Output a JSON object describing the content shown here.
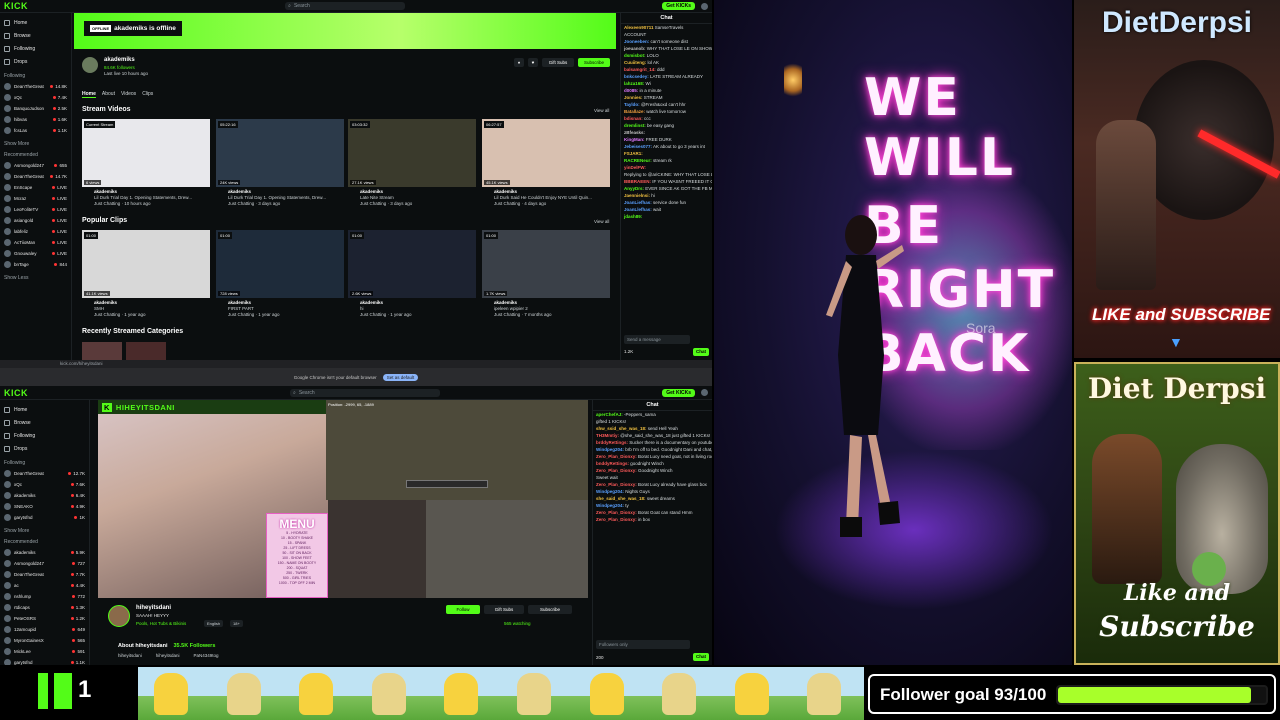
{
  "top_pane": {
    "logo": "KICK",
    "search_placeholder": "Search",
    "get_kick": "Get KICKs",
    "nav": [
      "Home",
      "Browse",
      "Following",
      "Drops"
    ],
    "following_header": "Following",
    "following": [
      {
        "name": "DeanTheGreat",
        "sub": "IRL",
        "viewers": "14.8K"
      },
      {
        "name": "xQc",
        "sub": "Watch Party",
        "viewers": "7.4K"
      },
      {
        "name": "BanquoJudson",
        "sub": "Public Settlements",
        "viewers": "2.5K"
      },
      {
        "name": "hibvas",
        "sub": "Pools, Hot Tubs",
        "viewers": "1.6K"
      },
      {
        "name": "fcsLas",
        "sub": "Just Chatting",
        "viewers": "1.1K"
      }
    ],
    "show_more": "Show More",
    "recommended_header": "Recommended",
    "recommended": [
      {
        "name": "Asmongold247",
        "sub": "World of Warcraft",
        "viewers": "655"
      },
      {
        "name": "DeanTheGreat",
        "sub": "IRL",
        "viewers": "14.7K"
      },
      {
        "name": "EnScape",
        "sub": "Old School RuneScape",
        "viewers": "LIVE"
      },
      {
        "name": "Mcraz",
        "sub": "Just Chatting",
        "viewers": "LIVE"
      },
      {
        "name": "LeoFoliteTV",
        "sub": "Slots & Casino",
        "viewers": "LIVE"
      },
      {
        "name": "asiangold",
        "sub": "Just Chatting",
        "viewers": "LIVE"
      },
      {
        "name": "labfeliz",
        "sub": "Just Chatting",
        "viewers": "LIVE"
      },
      {
        "name": "AcTiioMan",
        "sub": "Slots & Casino",
        "viewers": "LIVE"
      },
      {
        "name": "Gnouwaley",
        "sub": "Old School RuneScape",
        "viewers": "LIVE"
      },
      {
        "name": "bnTage",
        "sub": "Just Chatting",
        "viewers": "844"
      }
    ],
    "show_less": "Show Less",
    "banner_offline_label": "OFFLINE",
    "banner_text": "akademiks is offline",
    "profile": {
      "name": "akademiks",
      "followers": "84.6K followers",
      "last_live": "Last live 10 hours ago",
      "gift_subs": "Gift Subs",
      "subscribe": "Subscribe"
    },
    "tabs": [
      "Home",
      "About",
      "Videos",
      "Clips"
    ],
    "stream_videos_title": "Stream Videos",
    "view_all": "View all",
    "videos": [
      {
        "tag": "Current Stream",
        "dur": "",
        "views": "6 views",
        "author": "akademiks",
        "title": "Lil Durk Trial Day 1. Opening Statements, Drew...",
        "meta": "Just Chatting · 10 hours ago"
      },
      {
        "tag": "",
        "dur": "05:22:16",
        "views": "24K views",
        "author": "akademiks",
        "title": "Lil Durk Trial Day 1. Opening Statements, Drew...",
        "meta": "Just Chatting · 3 days ago"
      },
      {
        "tag": "",
        "dur": "03:03:32",
        "views": "27.1K views",
        "author": "akademiks",
        "title": "Late Nite Stream",
        "meta": "Just Chatting · 3 days ago"
      },
      {
        "tag": "",
        "dur": "06:27:57",
        "views": "45.1K views",
        "author": "akademiks",
        "title": "Lil Durk Said He Couldn't Enjoy NYE Until Quin...",
        "meta": "Just Chatting · 4 days ago"
      }
    ],
    "popular_clips_title": "Popular Clips",
    "clips": [
      {
        "dur": "01:00",
        "views": "41.1K views",
        "author": "akademiks",
        "title": "SMH",
        "meta": "Just Chatting · 1 year ago"
      },
      {
        "dur": "01:00",
        "views": "728 views",
        "author": "akademiks",
        "title": "FIRST PART",
        "meta": "Just Chatting · 1 year ago"
      },
      {
        "dur": "01:00",
        "views": "2.6K views",
        "author": "akademiks",
        "title": "hi",
        "meta": "Just Chatting · 1 year ago"
      },
      {
        "dur": "01:00",
        "views": "1.7K views",
        "author": "akademiks",
        "title": "ipeleen wpipier 2",
        "meta": "Just Chatting · 7 months ago"
      }
    ],
    "recent_categories_title": "Recently Streamed Categories",
    "chat": {
      "header": "Chat",
      "messages": [
        {
          "u": "Alexeen90711",
          "c": "#f0c040",
          "t": "SamseTravels"
        },
        {
          "u": "",
          "c": "#d9dee0",
          "t": "ACCOUNT"
        },
        {
          "u": "Jooneeben:",
          "c": "#5aa0ff",
          "t": "can't someone dist"
        },
        {
          "u": "joeuanob:",
          "c": "#c0c0c0",
          "t": "WHY THAT LOSE LE ON SHOW?!"
        },
        {
          "u": "dsmisbot:",
          "c": "#53fc18",
          "t": "LOLO"
        },
        {
          "u": "Cuuiiteng:",
          "c": "#f0c040",
          "t": "lol AK"
        },
        {
          "u": "balsamgrit_14:",
          "c": "#ff5a5a",
          "t": "ddd"
        },
        {
          "u": "bnkcsedey:",
          "c": "#5aa0ff",
          "t": "LATE STREAM ALREADY"
        },
        {
          "u": "lahza168:",
          "c": "#53fc18",
          "t": "Wi"
        },
        {
          "u": "d0085:",
          "c": "#e07aff",
          "t": "in a minute"
        },
        {
          "u": "Jonnies:",
          "c": "#f0c040",
          "t": "STREAM"
        },
        {
          "u": "Tayldo:",
          "c": "#5aa0ff",
          "t": "@Fresh&oxd can't hhr"
        },
        {
          "u": "Batallaze:",
          "c": "#f0a040",
          "t": "watch live tomorrow"
        },
        {
          "u": "bdisnan:",
          "c": "#ff5a5a",
          "t": "ccc"
        },
        {
          "u": "dremlinst:",
          "c": "#53fc18",
          "t": "be easy gang"
        },
        {
          "u": "zBfeasks:",
          "c": "#c0c0c0",
          "t": ""
        },
        {
          "u": "KingMan:",
          "c": "#e07aff",
          "t": "FREE DURK"
        },
        {
          "u": "Jebeises077:",
          "c": "#5aa0ff",
          "t": "AK about to go 3 years int"
        },
        {
          "u": "FSJAR1:",
          "c": "#f0c040",
          "t": ""
        },
        {
          "u": "RACRENeur:",
          "c": "#53fc18",
          "t": "stream rk"
        },
        {
          "u": "yinDelFW:",
          "c": "#ff5a5a",
          "t": ""
        },
        {
          "u": "",
          "c": "#d9dee0",
          "t": "Replying to @ariCKINE: WHY THAT LOSE LE ON"
        },
        {
          "u": "BBBRAEEN:",
          "c": "#ff5a5a",
          "t": "IF YOU WASNT FREEED IT OUT YET - HE'S A LIBERAL SHILL"
        },
        {
          "u": "AnyyDrs:",
          "c": "#53fc18",
          "t": "EVER SINCE AK GOT THE FB MONTHLY ALLOWANCE SAPPING JOY PURSHAT"
        },
        {
          "u": "Jaennielnsi:",
          "c": "#f0c040",
          "t": "hi"
        },
        {
          "u": "JoanLiefhas:",
          "c": "#5aa0ff",
          "t": "service done fun"
        },
        {
          "u": "JoanLlefhas:",
          "c": "#5aa0ff",
          "t": "wait"
        },
        {
          "u": "jdash89:",
          "c": "#53fc18",
          "t": ""
        }
      ],
      "input_placeholder": "Send a message",
      "count": "1.2K",
      "send": "Chat"
    }
  },
  "url_bar": "kick.com/hiheyitsdani",
  "infobar": {
    "text": "Google Chrome isn't your default browser",
    "button": "Set as default"
  },
  "bottom_pane": {
    "logo": "KICK",
    "search_placeholder": "Search",
    "get_kick": "Get KICKs",
    "nav": [
      "Home",
      "Browse",
      "Following",
      "Drops"
    ],
    "following_header": "Following",
    "following": [
      {
        "name": "DeanTheGreat",
        "sub": "IRL",
        "viewers": "12.7K"
      },
      {
        "name": "xQc",
        "sub": "Jeopardy Party Plays",
        "viewers": "7.6K"
      },
      {
        "name": "akademiks",
        "sub": "Just Chatting",
        "viewers": "6.4K"
      },
      {
        "name": "SNEAKO",
        "sub": "Just Chatting",
        "viewers": "4.9K"
      },
      {
        "name": "garytsfnd",
        "sub": "IRL",
        "viewers": "1K"
      }
    ],
    "show_more": "Show More",
    "recommended_header": "Recommended",
    "recommended": [
      {
        "name": "akademiks",
        "sub": "Just Chatting",
        "viewers": "5.9K"
      },
      {
        "name": "Asmongold247",
        "sub": "World of Warcraft",
        "viewers": "727"
      },
      {
        "name": "DeanTheGreat",
        "sub": "IRL",
        "viewers": "7.7K"
      },
      {
        "name": "ac",
        "sub": "",
        "viewers": "4.4K"
      },
      {
        "name": "nshlump",
        "sub": "Slots & Casino",
        "viewers": "772"
      },
      {
        "name": "rtdicaps",
        "sub": "Old School RuneScape",
        "viewers": "1.3K"
      },
      {
        "name": "PeteOSRS",
        "sub": "Old School RuneScape",
        "viewers": "1.2K"
      },
      {
        "name": "12amcupid",
        "sub": "Slots & Casino",
        "viewers": "649"
      },
      {
        "name": "MyronGainesX",
        "sub": "Just Chatting",
        "viewers": "565"
      },
      {
        "name": "MickLee",
        "sub": "Just Chatting",
        "viewers": "591"
      },
      {
        "name": "garytsfnd",
        "sub": "IRL",
        "viewers": "1.1K"
      }
    ],
    "stream_title_overlay": "HIHEYITSDANI",
    "stream_title_logo": "K",
    "mc_coords": "Position: -2999, 65, -1889",
    "menu_title": "MENU",
    "menu_lines": [
      "5 - HYDRATE",
      "10 - BOOTY SHAKE",
      "15 - SPANK",
      "25 - LIFT DRESS",
      "50 - SIT ON BACK",
      "100 - SHOW FEET",
      "150 - NAME ON BOOTY",
      "200 - SQUAT",
      "250 - TWERK",
      "500 - GIRL TRIES",
      "1000 - TOP OFF 2 MIN"
    ],
    "streamer": {
      "name": "hiheyitsdani",
      "title": "SAAAH! HEYYY",
      "category": "Pools, Hot Tubs & Bikinis",
      "pills": [
        "English",
        "18+"
      ],
      "follow": "Follow",
      "gift_subs": "Gift Subs",
      "subscribe": "Subscribe",
      "watching": "565 watching",
      "about": "About hiheyitsdani",
      "followers": "35.5K Followers",
      "socials": [
        "hiheyitsdani",
        "hiheyitsdani",
        "PaN4349tog"
      ]
    },
    "chat": {
      "header": "Chat",
      "messages": [
        {
          "u": "aperChefAJ:",
          "c": "#53fc18",
          "t": "-Peppers_sama"
        },
        {
          "u": "",
          "c": "#d9dee0",
          "t": "gifted 1 KICKs!"
        },
        {
          "u": "shw_ssid_she_was_18:",
          "c": "#f0c040",
          "t": "send Hell Yeah"
        },
        {
          "u": "TH3Mmtiy:",
          "c": "#ff5a5a",
          "t": "@she_said_she_was_18 just gifted 1 KICKs!"
        },
        {
          "u": "brddyRettings:",
          "c": "#ff5a5a",
          "t": "Sucker there is a documentary on youtube about it but its very long and boring"
        },
        {
          "u": "Windpeg204:",
          "c": "#5aa0ff",
          "t": "brb I'm off to bed. Goodnight Dani and chat, not sure about the petting zoo in the living room"
        },
        {
          "u": "Zero_Plan_Dionxy:",
          "c": "#ff5a5a",
          "t": "Borat Lucy need goat, not in living room, in glass box"
        },
        {
          "u": "bnddyRettings:",
          "c": "#ff5a5a",
          "t": "goodnight Winch"
        },
        {
          "u": "Zero_Plan_Dionxy:",
          "c": "#ff5a5a",
          "t": "Goodnight Winch"
        },
        {
          "u": "",
          "c": "#d9dee0",
          "t": "Sweet wait"
        },
        {
          "u": "Zero_Plan_Dionxy:",
          "c": "#ff5a5a",
          "t": "Borat Lucy already have glass box"
        },
        {
          "u": "Windpeg204:",
          "c": "#5aa0ff",
          "t": "Nights Guys"
        },
        {
          "u": "she_said_she_was_18:",
          "c": "#f0c040",
          "t": "sweet dreams"
        },
        {
          "u": "Windpeg204:",
          "c": "#5aa0ff",
          "t": "ty"
        },
        {
          "u": "Zero_Plan_Dionxy:",
          "c": "#ff5a5a",
          "t": "Borat Goat can stand Hmm"
        },
        {
          "u": "Zero_Plan_Dionxy:",
          "c": "#ff5a5a",
          "t": "in box"
        }
      ],
      "input_placeholder": "Followers only",
      "count": "200",
      "send": "Chat"
    }
  },
  "obs": {
    "neon_lines": [
      "WE",
      "WILL",
      "BE",
      "RIGHT",
      "BACK"
    ],
    "sora": "Sora",
    "card1_title": "DietDerpsi",
    "card1_cta": "LIKE and SUBSCRIBE",
    "card2_title": "Diet Derpsi",
    "card2_cta_1": "Like and",
    "card2_cta_2": "Subscribe"
  },
  "bottom_bar": {
    "kick_count": "1",
    "follower_goal_text": "Follower goal 93/100",
    "follower_goal_progress": 0.93,
    "accent": "#53fc18"
  }
}
